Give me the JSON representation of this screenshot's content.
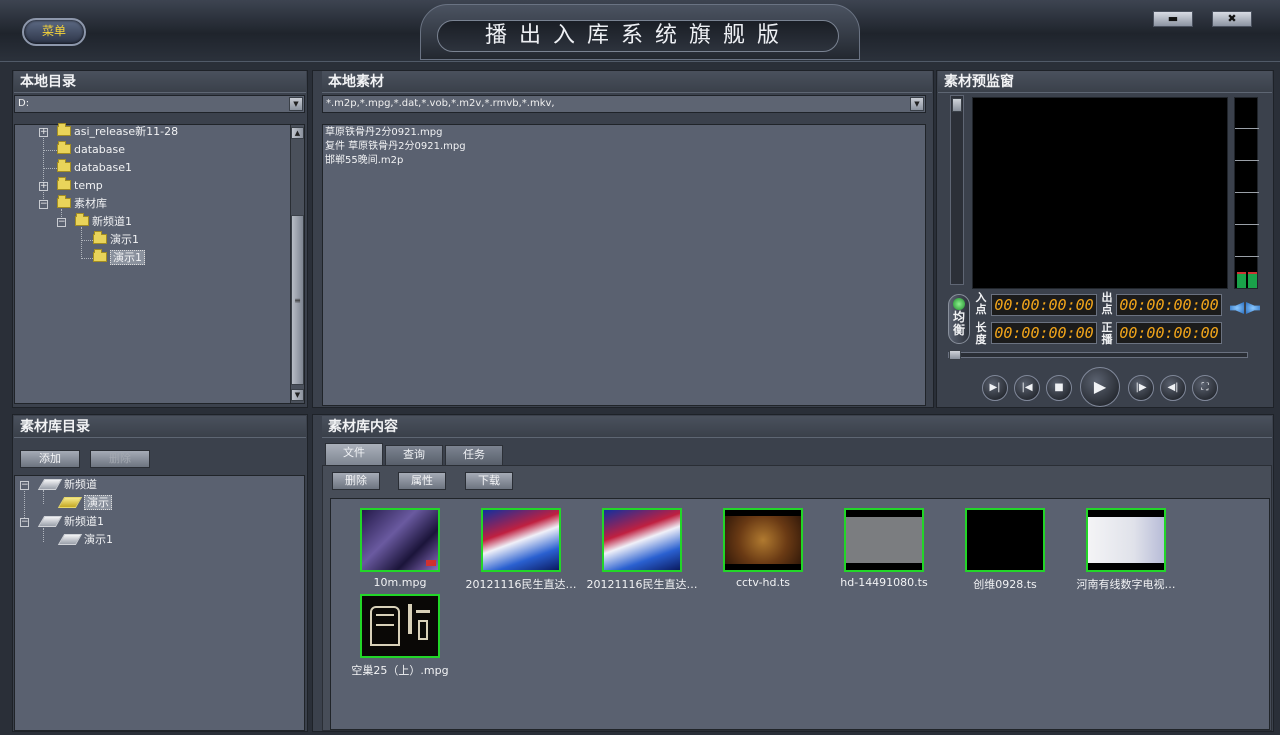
{
  "app": {
    "menu_label": "菜单",
    "title": "播出入库系统旗舰版",
    "minimize_label": "▬",
    "close_label": "✖"
  },
  "local_dir": {
    "header": "本地目录",
    "drive": "D:",
    "tree": [
      {
        "label": "asi_release新11-28",
        "expander": "+"
      },
      {
        "label": "database"
      },
      {
        "label": "database1"
      },
      {
        "label": "temp",
        "expander": "+"
      },
      {
        "label": "素材库",
        "expander": "−"
      },
      {
        "label": "新频道1",
        "expander": "−"
      },
      {
        "label": "演示1"
      },
      {
        "label": "演示1",
        "selected": true
      }
    ]
  },
  "local_material": {
    "header": "本地素材",
    "filter": "*.m2p,*.mpg,*.dat,*.vob,*.m2v,*.rmvb,*.mkv,",
    "files": [
      "草原铁骨丹2分0921.mpg",
      "复件 草原铁骨丹2分0921.mpg",
      "邯郸55晚间.m2p"
    ]
  },
  "preview": {
    "header": "素材预监窗",
    "eq_label": "均衡",
    "in_label": "入点",
    "out_label": "出点",
    "len_label": "长度",
    "play_label": "正播",
    "in_tc": "00:00:00:00",
    "out_tc": "00:00:00:00",
    "len_tc": "00:00:00:00",
    "play_tc": "00:00:00:00"
  },
  "library_dir": {
    "header": "素材库目录",
    "add_label": "添加",
    "delete_label": "删除",
    "tree": [
      {
        "label": "新频道",
        "expander": "−"
      },
      {
        "label": "演示",
        "selected": true
      },
      {
        "label": "新频道1",
        "expander": "−"
      },
      {
        "label": "演示1"
      }
    ]
  },
  "library_content": {
    "header": "素材库内容",
    "tabs": [
      "文件",
      "查询",
      "任务"
    ],
    "actions": {
      "delete": "删除",
      "properties": "属性",
      "download": "下载"
    },
    "items": [
      {
        "name": "10m.mpg",
        "icon": "city-night-thumbnail"
      },
      {
        "name": "20121116民生直达…",
        "icon": "studio-graphic-thumbnail"
      },
      {
        "name": "20121116民生直达…",
        "icon": "studio-graphic-thumbnail"
      },
      {
        "name": "cctv-hd.ts",
        "icon": "food-closeup-thumbnail"
      },
      {
        "name": "hd-14491080.ts",
        "icon": "gray-test-thumbnail"
      },
      {
        "name": "创维0928.ts",
        "icon": "black-thumbnail"
      },
      {
        "name": "河南有线数字电视…",
        "icon": "white-fade-thumbnail"
      },
      {
        "name": "空巢25（上）.mpg",
        "icon": "calligraphy-thumbnail"
      }
    ]
  },
  "colors": {
    "thumb_border": "#22d628",
    "timecode": "#f2a51a",
    "menu_text": "#f4d23a"
  }
}
